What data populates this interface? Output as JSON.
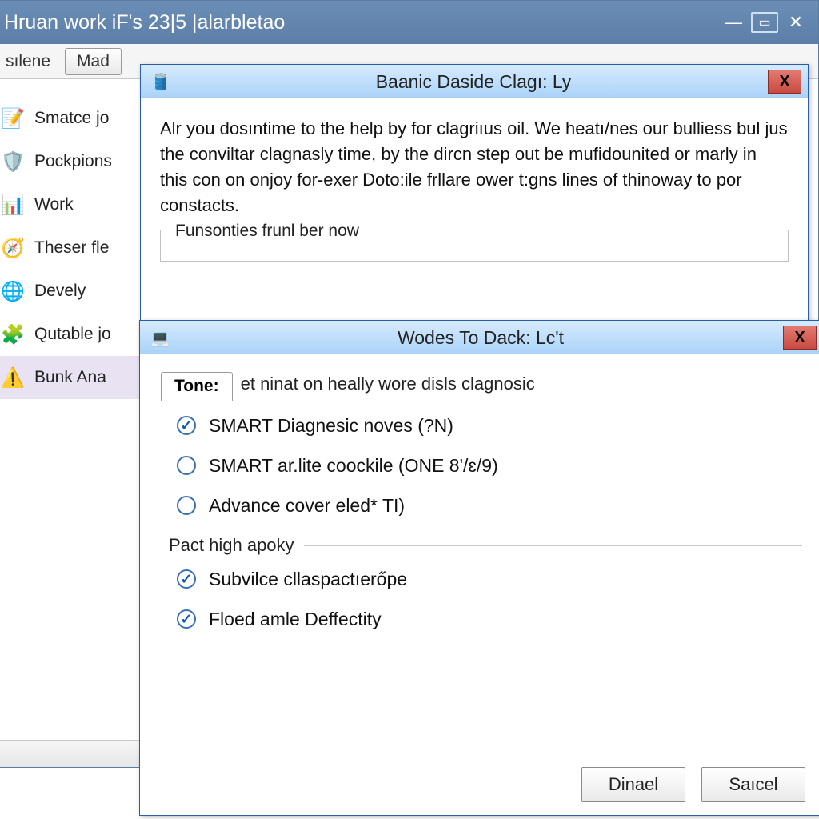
{
  "main": {
    "title": "Hruan work iF's 23|5 |alarbletao",
    "toolbar": {
      "btn1": "sılene",
      "btn2": "Mad"
    },
    "sidebar": [
      {
        "label": "Smatce jo",
        "icon": "📝",
        "selected": false
      },
      {
        "label": "Pockpions",
        "icon": "🛡️",
        "selected": false
      },
      {
        "label": "Work",
        "icon": "📊",
        "selected": false
      },
      {
        "label": "Theser fle",
        "icon": "🧭",
        "selected": false
      },
      {
        "label": "Devely",
        "icon": "🌐",
        "selected": false
      },
      {
        "label": "Qutable jo",
        "icon": "🧩",
        "selected": false
      },
      {
        "label": "Bunk Ana",
        "icon": "⚠️",
        "selected": true
      }
    ]
  },
  "dialog1": {
    "title": "Baanic Daside Clagı: Ly",
    "icon": "🛢️",
    "text": "Alr you dosıntime to the help by for clagriıus oil. We heatı/nes our bulliess bul jus the conviltar clagnasly time, by the dircn step out be mufidounited or marly in this con on onjoy for-exer Doto:ile frllare ower t:gns lines of thinoway to por constacts.",
    "group": "Funsonties frunl ber now"
  },
  "dialog2": {
    "title": "Wodes To Dack: Lc't",
    "icon": "💻",
    "tab": "Tone:",
    "tabtext": "et ninat on heally wore disls clagnosic",
    "opts1": [
      {
        "label": "SMART Diagnesic noves (?N)",
        "checked": true
      },
      {
        "label": "SMART ar.lite coockile (ONE 8'/ɛ/9)",
        "checked": false
      },
      {
        "label": "Advance cover eled* TI)",
        "checked": false
      }
    ],
    "section2": "Pact high apoky",
    "opts2": [
      {
        "label": "Subvilce cllaspactıerőpe",
        "checked": true
      },
      {
        "label": "Floed amle Deffectity",
        "checked": true
      }
    ],
    "btn_ok": "Dinael",
    "btn_cancel": "Saıcel"
  }
}
